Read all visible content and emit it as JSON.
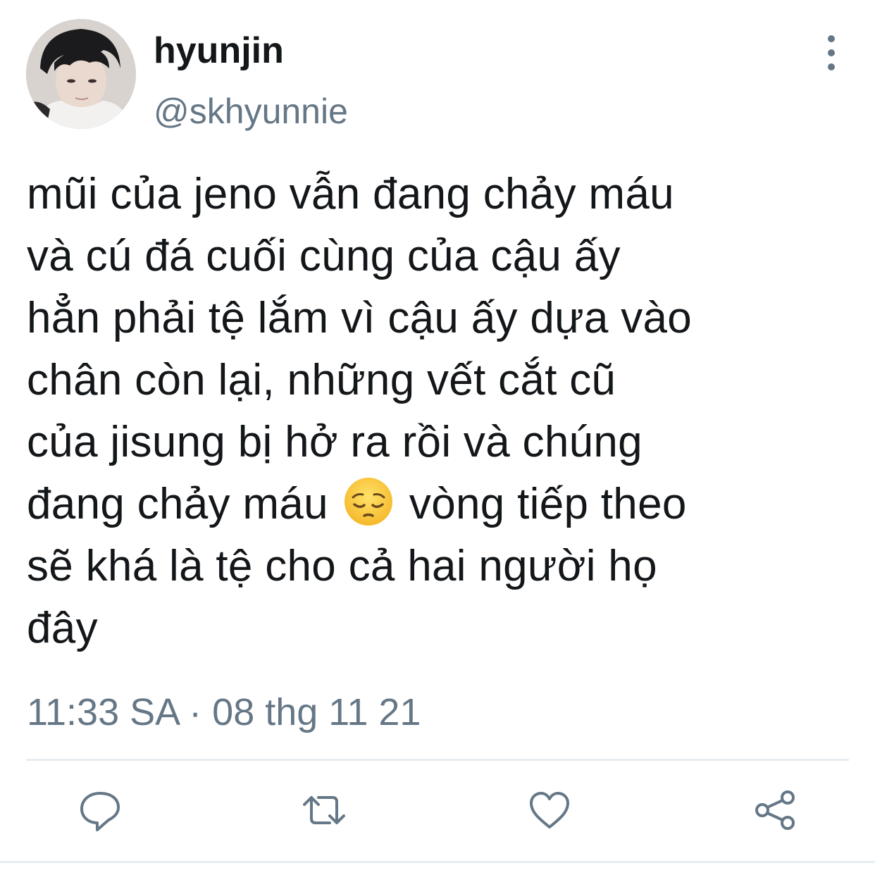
{
  "user": {
    "display_name": "hyunjin",
    "handle": "@skhyunnie"
  },
  "tweet": {
    "lines": [
      "mũi của jeno vẫn đang chảy máu",
      "và cú đá cuối cùng của cậu ấy",
      "hẳn phải tệ lắm vì cậu ấy dựa vào",
      "chân còn lại, những vết cắt cũ",
      "của jisung bị hở ra rồi và chúng"
    ],
    "line6_before_emoji": "đang chảy máu",
    "emoji": "pensive-face-emoji",
    "line6_after_emoji": "vòng tiếp theo",
    "lines_end": [
      "sẽ khá là tệ cho cả hai người họ",
      "đây"
    ],
    "timestamp": "11:33 SA · 08 thg 11 21"
  },
  "actions": {
    "reply_icon": "reply-icon",
    "retweet_icon": "retweet-icon",
    "like_icon": "heart-icon",
    "share_icon": "share-icon"
  },
  "colors": {
    "text": "#14171a",
    "secondary": "#657786",
    "divider": "#e6ecf0"
  }
}
